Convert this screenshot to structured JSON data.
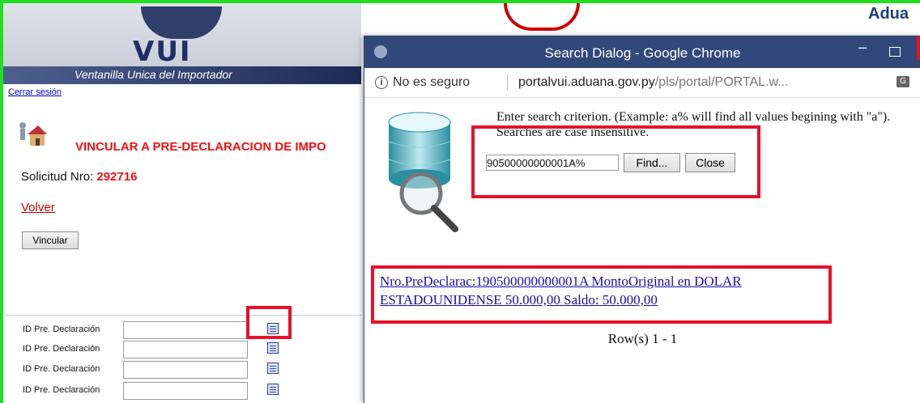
{
  "header": {
    "logo_text": "VUI",
    "subtitle": "Ventanilla Unica del Importador",
    "brand_right": "Adua"
  },
  "page": {
    "logout_link": "Cerrar sesión",
    "title": "VINCULAR A PRE-DECLARACION DE IMPO",
    "solicitud_label": "Solicitud Nro:",
    "solicitud_number": "292716",
    "back_link": "Volver",
    "link_button": "Vincular",
    "id_rows": [
      {
        "label": "ID Pre. Declaración"
      },
      {
        "label": "ID Pre. Declaración"
      },
      {
        "label": "ID Pre. Declaración"
      },
      {
        "label": "ID Pre. Declaración"
      }
    ]
  },
  "dialog": {
    "window_title": "Search Dialog - Google Chrome",
    "security_label": "No es seguro",
    "url_host": "portalvui.aduana.gov.py",
    "url_path": "/pls/portal/PORTAL.w...",
    "instructions": "Enter search criterion. (Example: a% will find all values begining with \"a\"). Searches are case insensitive.",
    "search_value": "90500000000001A%",
    "find_button": "Find...",
    "close_button": "Close",
    "result_line1": "Nro.PreDeclarac:190500000000001A MontoOriginal en DOLAR",
    "result_line2": "ESTADOUNIDENSE 50.000,00 Saldo: 50.000,00",
    "rows_text": "Row(s) 1 - 1"
  },
  "colors": {
    "accent_red": "#e8102a",
    "frame_green": "#22dd22",
    "titlebar": "#33487a",
    "link_blue": "#1a0dab"
  }
}
